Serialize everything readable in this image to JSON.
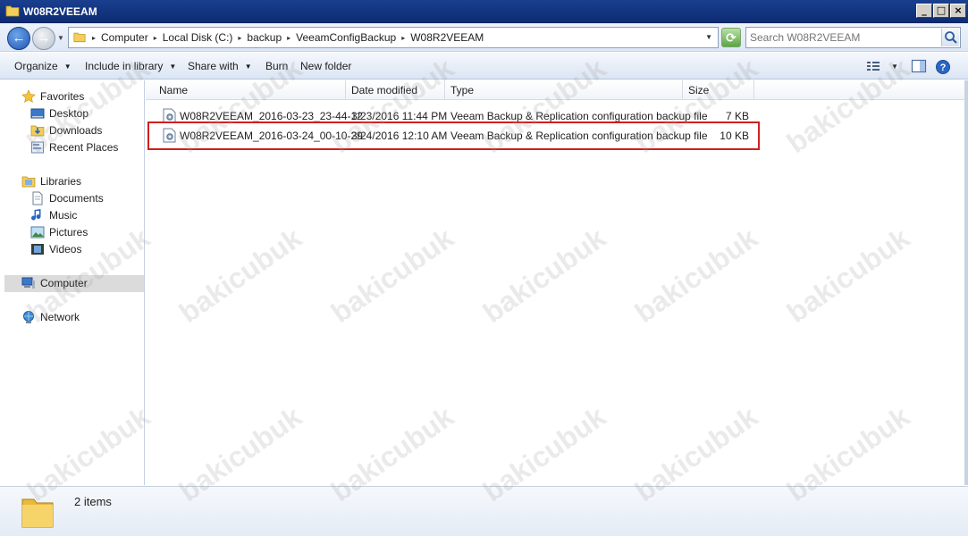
{
  "window": {
    "title": "W08R2VEEAM"
  },
  "address": {
    "crumbs": [
      "Computer",
      "Local Disk (C:)",
      "backup",
      "VeeamConfigBackup",
      "W08R2VEEAM"
    ]
  },
  "search": {
    "placeholder": "Search W08R2VEEAM"
  },
  "toolbar": {
    "organize": "Organize",
    "include_in_library": "Include in library",
    "share_with": "Share with",
    "burn": "Burn",
    "new_folder": "New folder"
  },
  "nav": {
    "favorites": "Favorites",
    "desktop": "Desktop",
    "downloads": "Downloads",
    "recent_places": "Recent Places",
    "libraries": "Libraries",
    "documents": "Documents",
    "music": "Music",
    "pictures": "Pictures",
    "videos": "Videos",
    "computer": "Computer",
    "network": "Network"
  },
  "columns": {
    "name": "Name",
    "date_modified": "Date modified",
    "type": "Type",
    "size": "Size"
  },
  "files": [
    {
      "name": "W08R2VEEAM_2016-03-23_23-44-12",
      "date": "3/23/2016 11:44 PM",
      "type": "Veeam Backup & Replication configuration backup file",
      "size": "7 KB"
    },
    {
      "name": "W08R2VEEAM_2016-03-24_00-10-29",
      "date": "3/24/2016 12:10 AM",
      "type": "Veeam Backup & Replication configuration backup file",
      "size": "10 KB"
    }
  ],
  "status": {
    "item_count": "2 items"
  },
  "watermark": "bakicubuk",
  "colors": {
    "highlight": "#d21e1e",
    "titlebar": "#0c2c72"
  }
}
